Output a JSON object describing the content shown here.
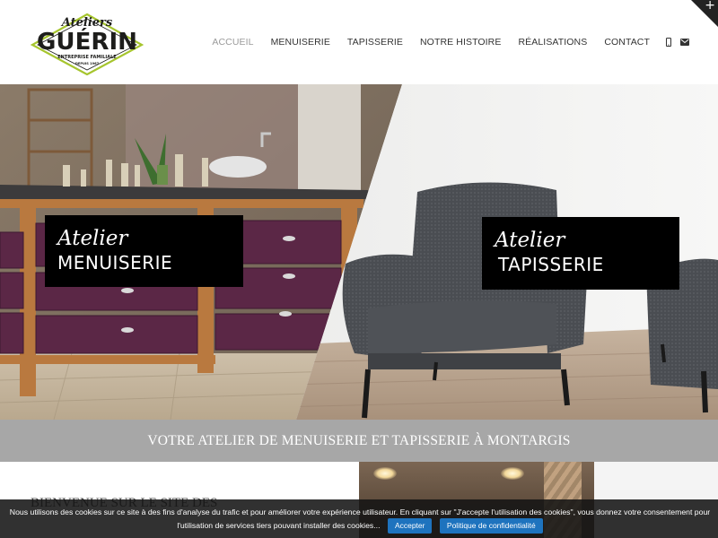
{
  "header": {
    "logo": {
      "script_text": "Ateliers",
      "name_text": "GUÉRIN",
      "tagline": "ENTREPRISE FAMILIALE",
      "since": "DEPUIS 1967"
    },
    "nav": {
      "items": [
        {
          "label": "ACCUEIL",
          "active": true
        },
        {
          "label": "MENUISERIE",
          "active": false
        },
        {
          "label": "TAPISSERIE",
          "active": false
        },
        {
          "label": "NOTRE HISTOIRE",
          "active": false
        },
        {
          "label": "RÉALISATIONS",
          "active": false
        },
        {
          "label": "CONTACT",
          "active": false
        }
      ],
      "icons": [
        "mobile-phone-icon",
        "envelope-icon"
      ]
    },
    "corner_toggle": {
      "symbol": "+"
    }
  },
  "hero": {
    "left_tag": {
      "script": "Atelier",
      "title": "MENUISERIE"
    },
    "right_tag": {
      "script": "Atelier",
      "title": "TAPISSERIE"
    }
  },
  "banner": {
    "text": "VOTRE ATELIER DE MENUISERIE ET TAPISSERIE À MONTARGIS"
  },
  "below": {
    "welcome_heading": "BIENVENUE SUR LE SITE DES"
  },
  "cookie_bar": {
    "text_line1": "Nous utilisons des cookies sur ce site à des fins d'analyse du trafic et pour améliorer votre expérience utilisateur. En cliquant sur \"J'accepte l'utilisation des cookies\", vous donnez votre consentement pour",
    "text_line2": "l'utilisation de services tiers pouvant installer des cookies...",
    "accept_label": "Accepter",
    "privacy_label": "Politique de confidentialité"
  },
  "colors": {
    "banner": "#a7a7a7",
    "logo_green": "#a6c52e",
    "button_blue": "#1e73be",
    "nav_active": "#9a9a9a"
  }
}
